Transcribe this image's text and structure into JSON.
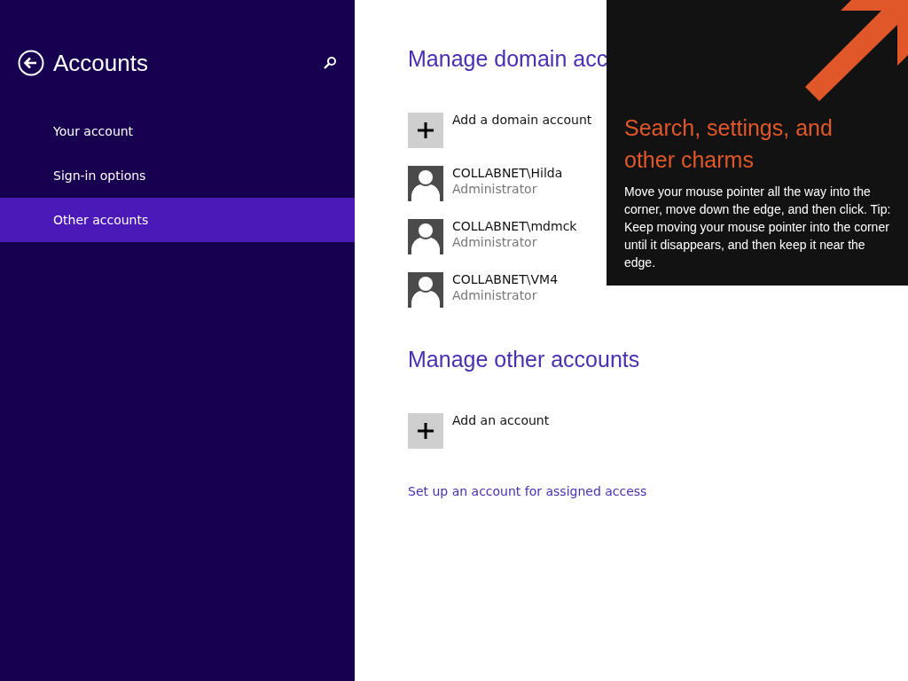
{
  "sidebar": {
    "title": "Accounts",
    "items": [
      {
        "label": "Your account",
        "selected": false
      },
      {
        "label": "Sign-in options",
        "selected": false
      },
      {
        "label": "Other accounts",
        "selected": true
      }
    ]
  },
  "main": {
    "sections": [
      {
        "heading": "Manage domain acc",
        "items": [
          {
            "kind": "add",
            "label": "Add a domain account"
          },
          {
            "kind": "user",
            "name": "COLLABNET\\Hilda",
            "role": "Administrator"
          },
          {
            "kind": "user",
            "name": "COLLABNET\\mdmck",
            "role": "Administrator"
          },
          {
            "kind": "user",
            "name": "COLLABNET\\VM4",
            "role": "Administrator"
          }
        ]
      },
      {
        "heading": "Manage other accounts",
        "items": [
          {
            "kind": "add",
            "label": "Add an account"
          }
        ]
      }
    ],
    "link": "Set up an account for assigned access"
  },
  "charms_tip": {
    "title": "Search, settings, and other charms",
    "body": "Move your mouse pointer all the way into the corner, move down the edge, and then click. Tip: Keep moving your mouse pointer into the corner until it disappears, and then keep it near the edge."
  }
}
